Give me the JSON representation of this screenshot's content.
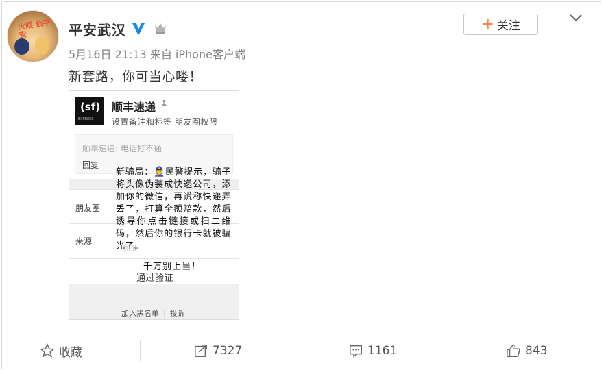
{
  "post": {
    "author": "平安武汉",
    "timestamp": "5月16日 21:13",
    "source": "来自 iPhone客户端",
    "text": "新套路，你可当心喽！",
    "follow_label": "关注",
    "avatar_text": "火眼 侦平安"
  },
  "image": {
    "contact_name": "顺丰速递",
    "contact_options": "设置备注和标签   朋友圈权限",
    "message": "顺丰速递: 电话打不通",
    "reply_label": "回复",
    "row_moments": "朋友圈",
    "row_source": "来源",
    "row_source_faint": "添加",
    "overlay_text": "新骗局：👮民警提示，骗子将头像伪装成快递公司，添加你的微信，再谎称快递弄丢了，打算全额赔款，然后诱导你点击链接或扫二维码，然后你的银行卡就被骗光了。",
    "warning": "千万别上当！",
    "verify_label": "通过验证",
    "blacklist_label": "加入黑名单",
    "report_label": "投诉"
  },
  "footer": {
    "favorite_label": "收藏",
    "repost_count": "7327",
    "comment_count": "1161",
    "like_count": "843"
  },
  "colors": {
    "accent": "#ff8140",
    "verified": "#ffa800"
  }
}
